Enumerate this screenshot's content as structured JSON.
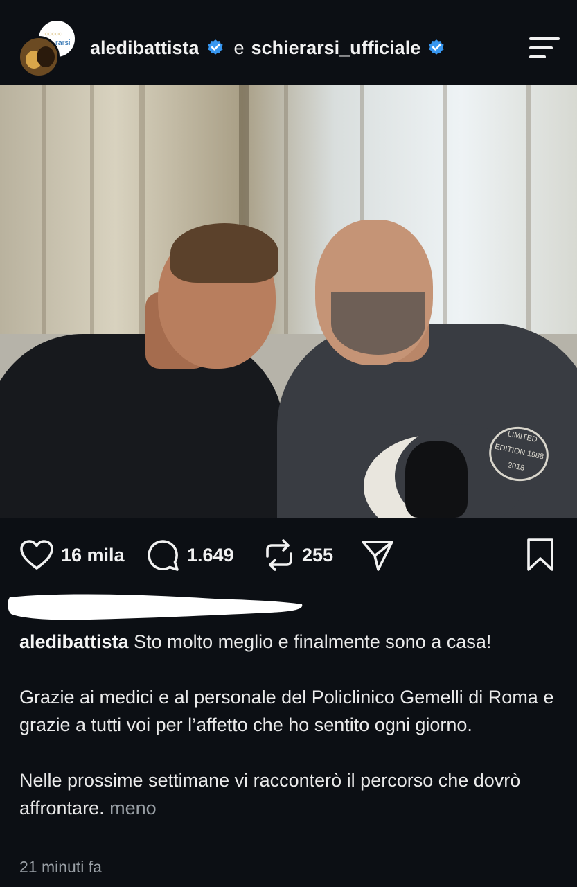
{
  "header": {
    "avatar_back_text": "rarsi",
    "user1": "aledibattista",
    "conjunction": "e",
    "user2": "schierarsi_ufficiale",
    "verified_color": "#3897f0",
    "menu_icon": "menu-icon"
  },
  "actions": {
    "likes": "16 mila",
    "comments": "1.649",
    "reposts": "255",
    "icons": [
      "heart-icon",
      "comment-icon",
      "repost-icon",
      "share-icon",
      "bookmark-icon"
    ]
  },
  "caption": {
    "username": "aledibattista",
    "line1": "Sto molto meglio e finalmente sono a casa!",
    "para2": "Grazie ai medici e al personale del Policlinico Gemelli di Roma e grazie a tutti voi per l’affetto che ho sentito ogni giorno.",
    "para3": "Nelle prossime settimane vi racconterò il percorso che dovrò affrontare.",
    "less_label": "meno"
  },
  "timestamp": "21 minuti fa",
  "photo": {
    "stamp_text": "LIMITED EDITION 1988 2018"
  }
}
